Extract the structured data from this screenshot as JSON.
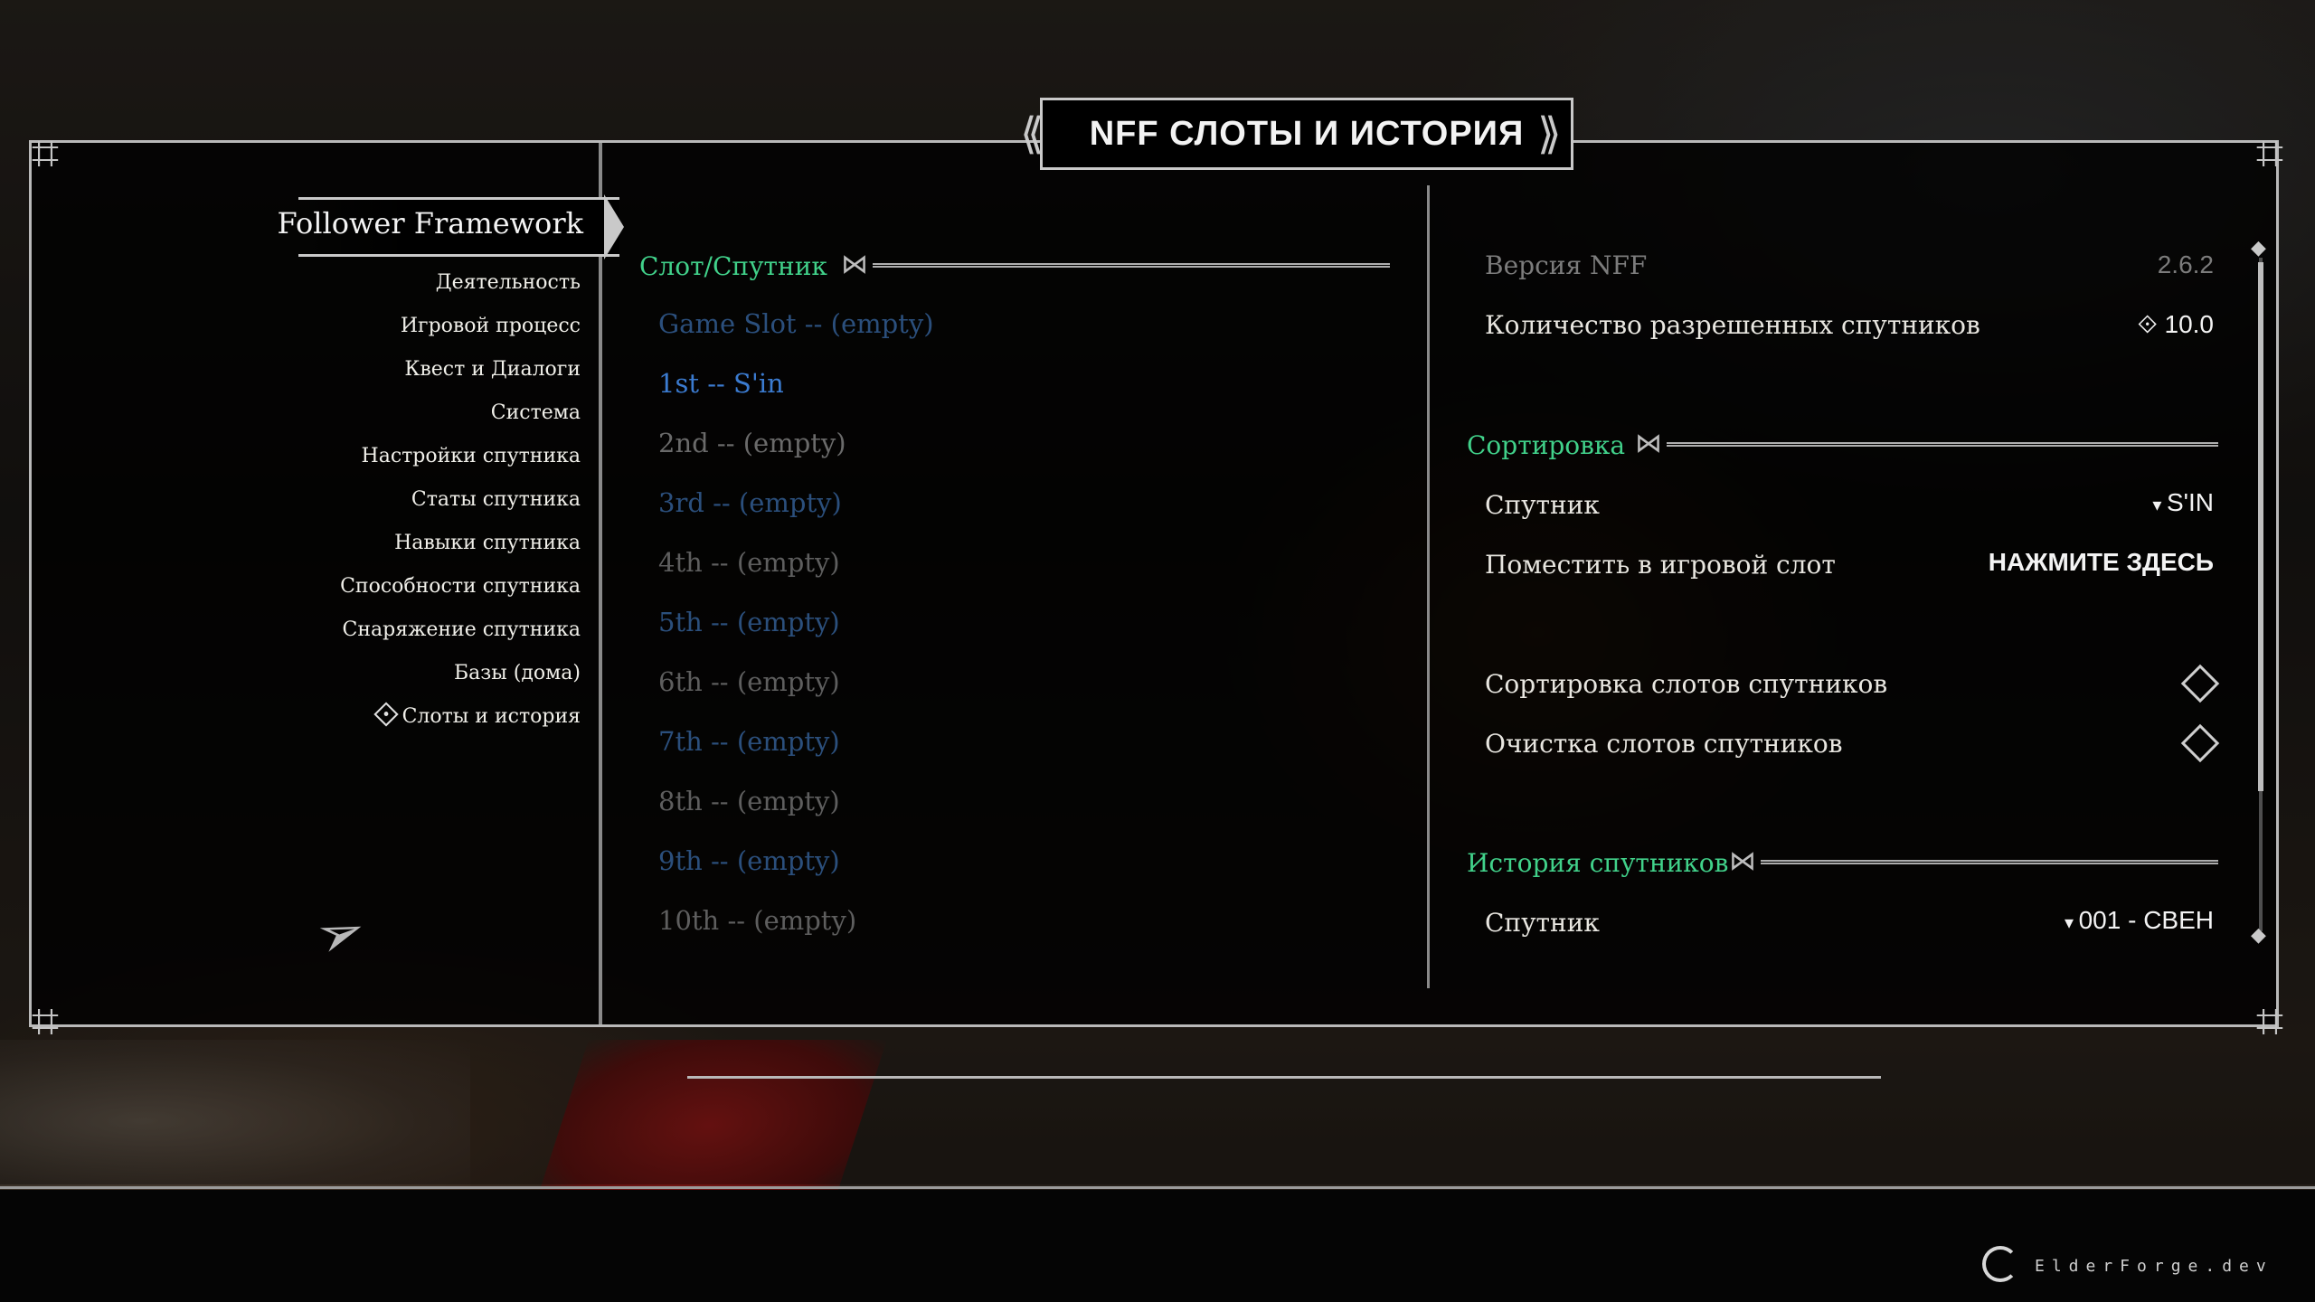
{
  "title": "NFF СЛОТЫ И ИСТОРИЯ",
  "sidebar": {
    "title": "Follower Framework",
    "items": [
      {
        "label": "Деятельность"
      },
      {
        "label": "Игровой процесс"
      },
      {
        "label": "Квест и Диалоги"
      },
      {
        "label": "Система"
      },
      {
        "label": "Настройки спутника"
      },
      {
        "label": "Статы спутника"
      },
      {
        "label": "Навыки спутника"
      },
      {
        "label": "Способности спутника"
      },
      {
        "label": "Снаряжение спутника"
      },
      {
        "label": "Базы (дома)"
      },
      {
        "label": "Слоты и история",
        "selected": true
      }
    ]
  },
  "slots": {
    "header": "Слот/Спутник",
    "items": [
      {
        "label": "Game Slot -- (empty)"
      },
      {
        "label": "1st -- S'in"
      },
      {
        "label": "2nd -- (empty)"
      },
      {
        "label": "3rd -- (empty)"
      },
      {
        "label": "4th -- (empty)"
      },
      {
        "label": "5th -- (empty)"
      },
      {
        "label": "6th -- (empty)"
      },
      {
        "label": "7th -- (empty)"
      },
      {
        "label": "8th -- (empty)"
      },
      {
        "label": "9th -- (empty)"
      },
      {
        "label": "10th -- (empty)"
      }
    ]
  },
  "info": {
    "version_label": "Версия NFF",
    "version_value": "2.6.2",
    "allowed_label": "Количество разрешенных спутников",
    "allowed_value": "10.0"
  },
  "sorting": {
    "header": "Сортировка",
    "follower_label": "Спутник",
    "follower_value": "S'IN",
    "place_label": "Поместить в игровой слот",
    "place_value": "НАЖМИТЕ ЗДЕСЬ",
    "sort_label": "Сортировка слотов спутников",
    "clear_label": "Очистка слотов спутников"
  },
  "history": {
    "header": "История спутников",
    "follower_label": "Спутник",
    "follower_value": "001 - СВЕН"
  },
  "watermark": "ElderForge.dev",
  "colors": {
    "accent_green": "#41d18a",
    "slot_blue": "#3b7bd0",
    "slot_blue_dim": "#2b4f7c",
    "muted_text": "#7c7c7c"
  }
}
